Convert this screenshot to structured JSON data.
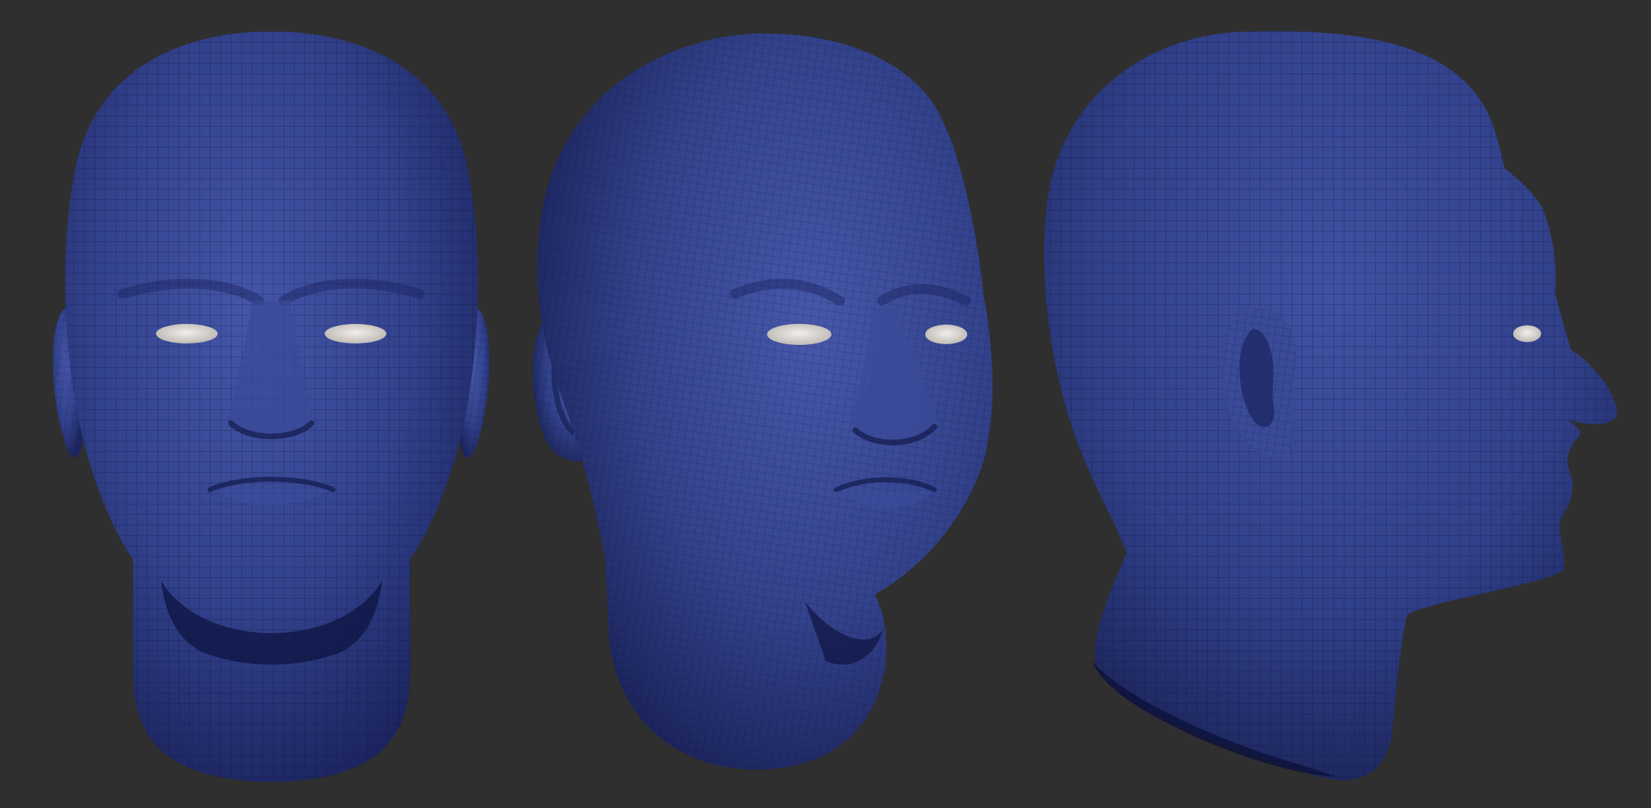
{
  "scene": {
    "background": "#2f2f2f",
    "mesh_color": "#2f3d82",
    "mesh_color_light": "#4c5eb4",
    "mesh_color_dark": "#141b44",
    "wire_color": "#0c1030",
    "eye_color": "#e8e4df",
    "views": [
      {
        "name": "front-view"
      },
      {
        "name": "three-quarter-view"
      },
      {
        "name": "side-view"
      }
    ]
  }
}
